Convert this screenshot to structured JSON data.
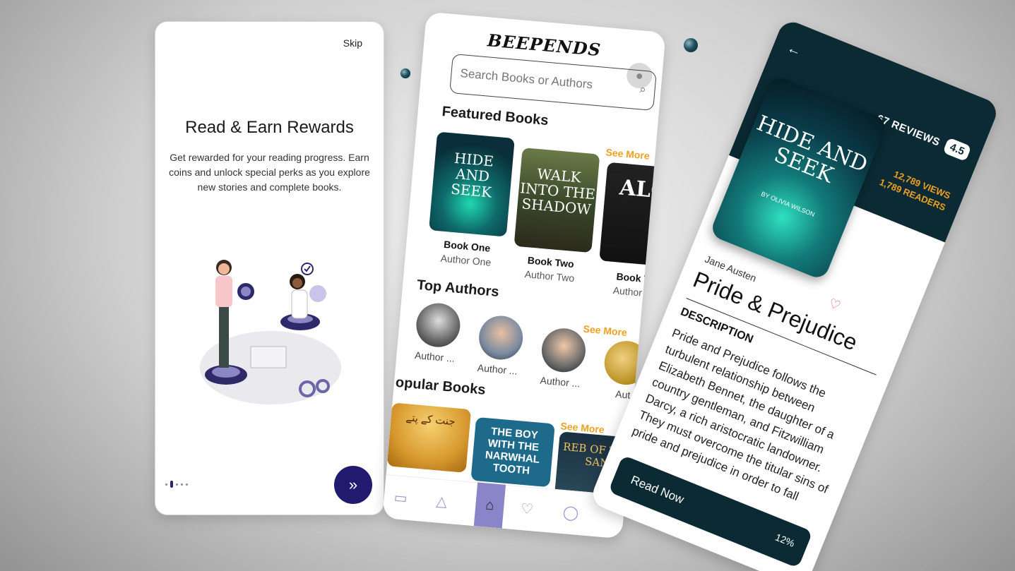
{
  "onboarding": {
    "skip_label": "Skip",
    "title": "Read & Earn Rewards",
    "description": "Get rewarded for your reading progress. Earn coins and unlock special perks as you explore new stories and complete books.",
    "next_icon": "double-chevron-right-icon",
    "page_index": 1,
    "page_count": 4
  },
  "home": {
    "logo": "BEEPENDS",
    "search": {
      "placeholder": "Search Books or Authors"
    },
    "featured": {
      "heading": "Featured Books",
      "see_more": "See More",
      "books": [
        {
          "cover_title": "HIDE AND SEEK",
          "title": "Book One",
          "author": "Author One"
        },
        {
          "cover_title": "WALK INTO THE SHADOW",
          "title": "Book Two",
          "author": "Author Two"
        },
        {
          "cover_title": "ALO",
          "title": "Book T",
          "author": "Author T"
        }
      ]
    },
    "top_authors": {
      "heading": "Top Authors",
      "see_more": "See More",
      "authors": [
        {
          "label": "Author ..."
        },
        {
          "label": "Author ..."
        },
        {
          "label": "Author ..."
        },
        {
          "label": "Aut"
        }
      ]
    },
    "popular": {
      "heading": "opular Books",
      "see_more": "See More",
      "covers": [
        "جنت کے پتے",
        "THE BOY WITH THE NARWHAL TOOTH",
        "REB OF THE SAN"
      ]
    },
    "nav": [
      "book-icon",
      "shapes-icon",
      "home-icon",
      "heart-icon",
      "user-icon"
    ]
  },
  "detail": {
    "reviews": "67 REVIEWS",
    "rating": "4.5",
    "views": "12,789 VIEWS",
    "readers": "1,789 READERS",
    "cover_title": "HIDE AND SEEK",
    "cover_subtitle": "BY OLIVIA WILSON",
    "author": "Jane Austen",
    "title": "Pride & Prejudice",
    "description_heading": "DESCRIPTION",
    "description": "Pride and Prejudice follows the turbulent relationship between Elizabeth Bennet, the daughter of a country gentleman, and Fitzwilliam Darcy, a rich aristocratic landowner. They must overcome the titular sins of pride and prejudice in order to fall",
    "read_label": "Read Now",
    "progress": "12%"
  },
  "colors": {
    "brand_navy": "#221a6e",
    "accent_orange": "#f0a020",
    "detail_dark": "#0b2a33",
    "nav_lavender": "#8a84c8"
  }
}
